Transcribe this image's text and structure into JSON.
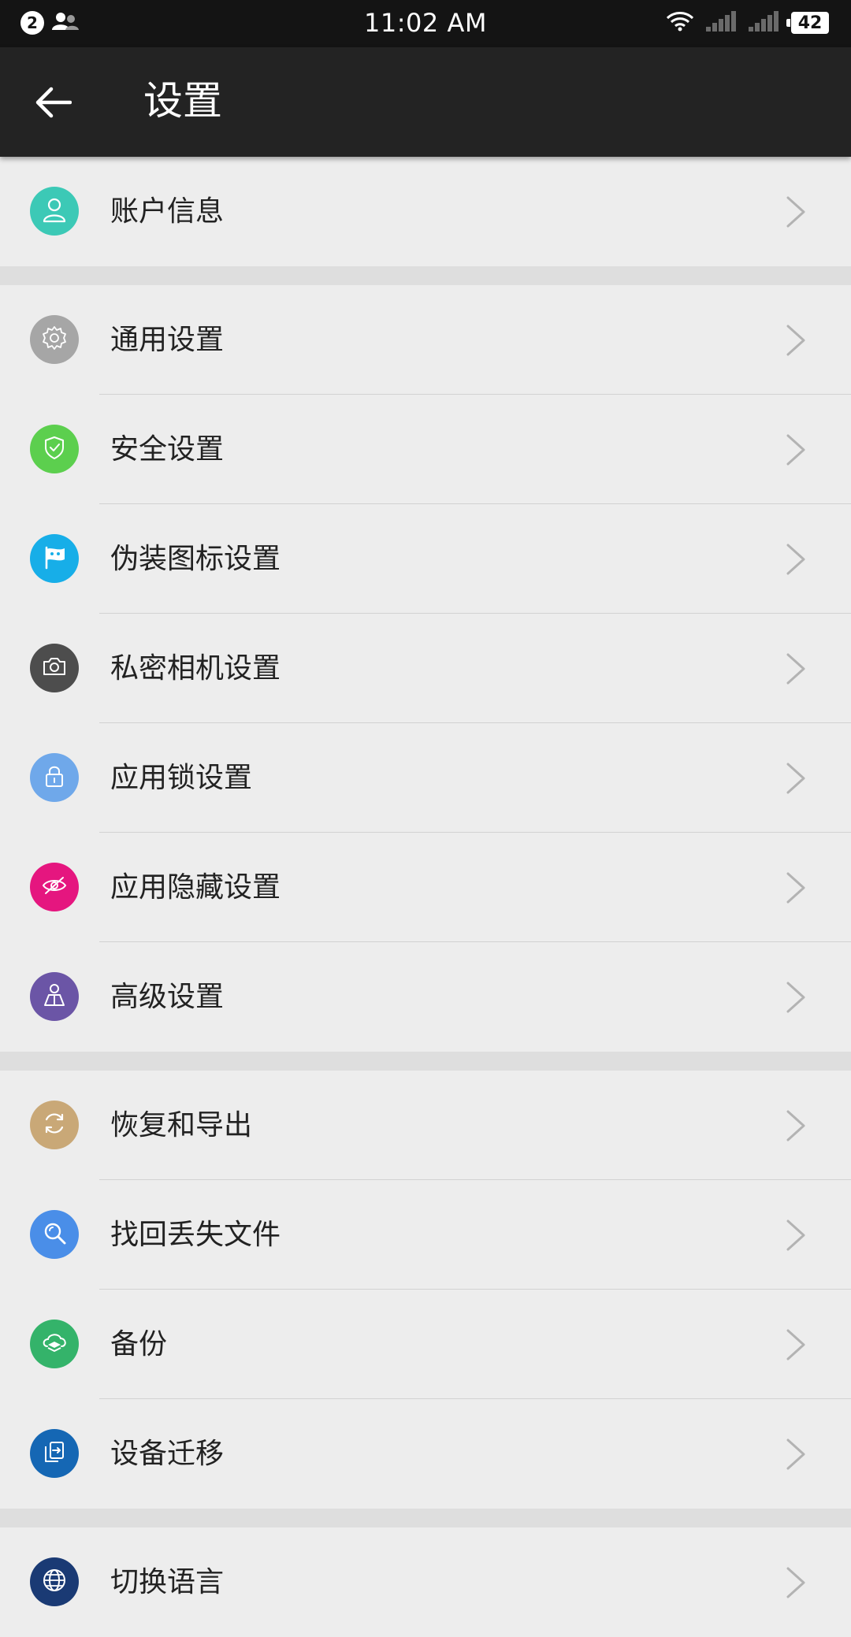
{
  "status_bar": {
    "notification_count": "2",
    "time": "11:02 AM",
    "battery": "42"
  },
  "app_bar": {
    "title": "设置"
  },
  "groups": [
    {
      "items": [
        {
          "label": "账户信息",
          "icon": "user-icon",
          "color": "#3cc9b6"
        }
      ]
    },
    {
      "items": [
        {
          "label": "通用设置",
          "icon": "gear-icon",
          "color": "#a6a6a6"
        },
        {
          "label": "安全设置",
          "icon": "shield-icon",
          "color": "#5ccf4e"
        },
        {
          "label": "伪装图标设置",
          "icon": "mask-flag-icon",
          "color": "#17aee8"
        },
        {
          "label": "私密相机设置",
          "icon": "camera-icon",
          "color": "#4d4d4d"
        },
        {
          "label": "应用锁设置",
          "icon": "lock-icon",
          "color": "#6fa8ea"
        },
        {
          "label": "应用隐藏设置",
          "icon": "eye-off-icon",
          "color": "#e5167f"
        },
        {
          "label": "高级设置",
          "icon": "advanced-icon",
          "color": "#6b55a6"
        }
      ]
    },
    {
      "items": [
        {
          "label": "恢复和导出",
          "icon": "refresh-icon",
          "color": "#c9a877"
        },
        {
          "label": "找回丢失文件",
          "icon": "search-icon",
          "color": "#4a8ee8"
        },
        {
          "label": "备份",
          "icon": "cloud-backup-icon",
          "color": "#34b36a"
        },
        {
          "label": "设备迁移",
          "icon": "transfer-icon",
          "color": "#1567b4"
        }
      ]
    },
    {
      "items": [
        {
          "label": "切换语言",
          "icon": "globe-icon",
          "color": "#1a3a74"
        }
      ]
    }
  ]
}
